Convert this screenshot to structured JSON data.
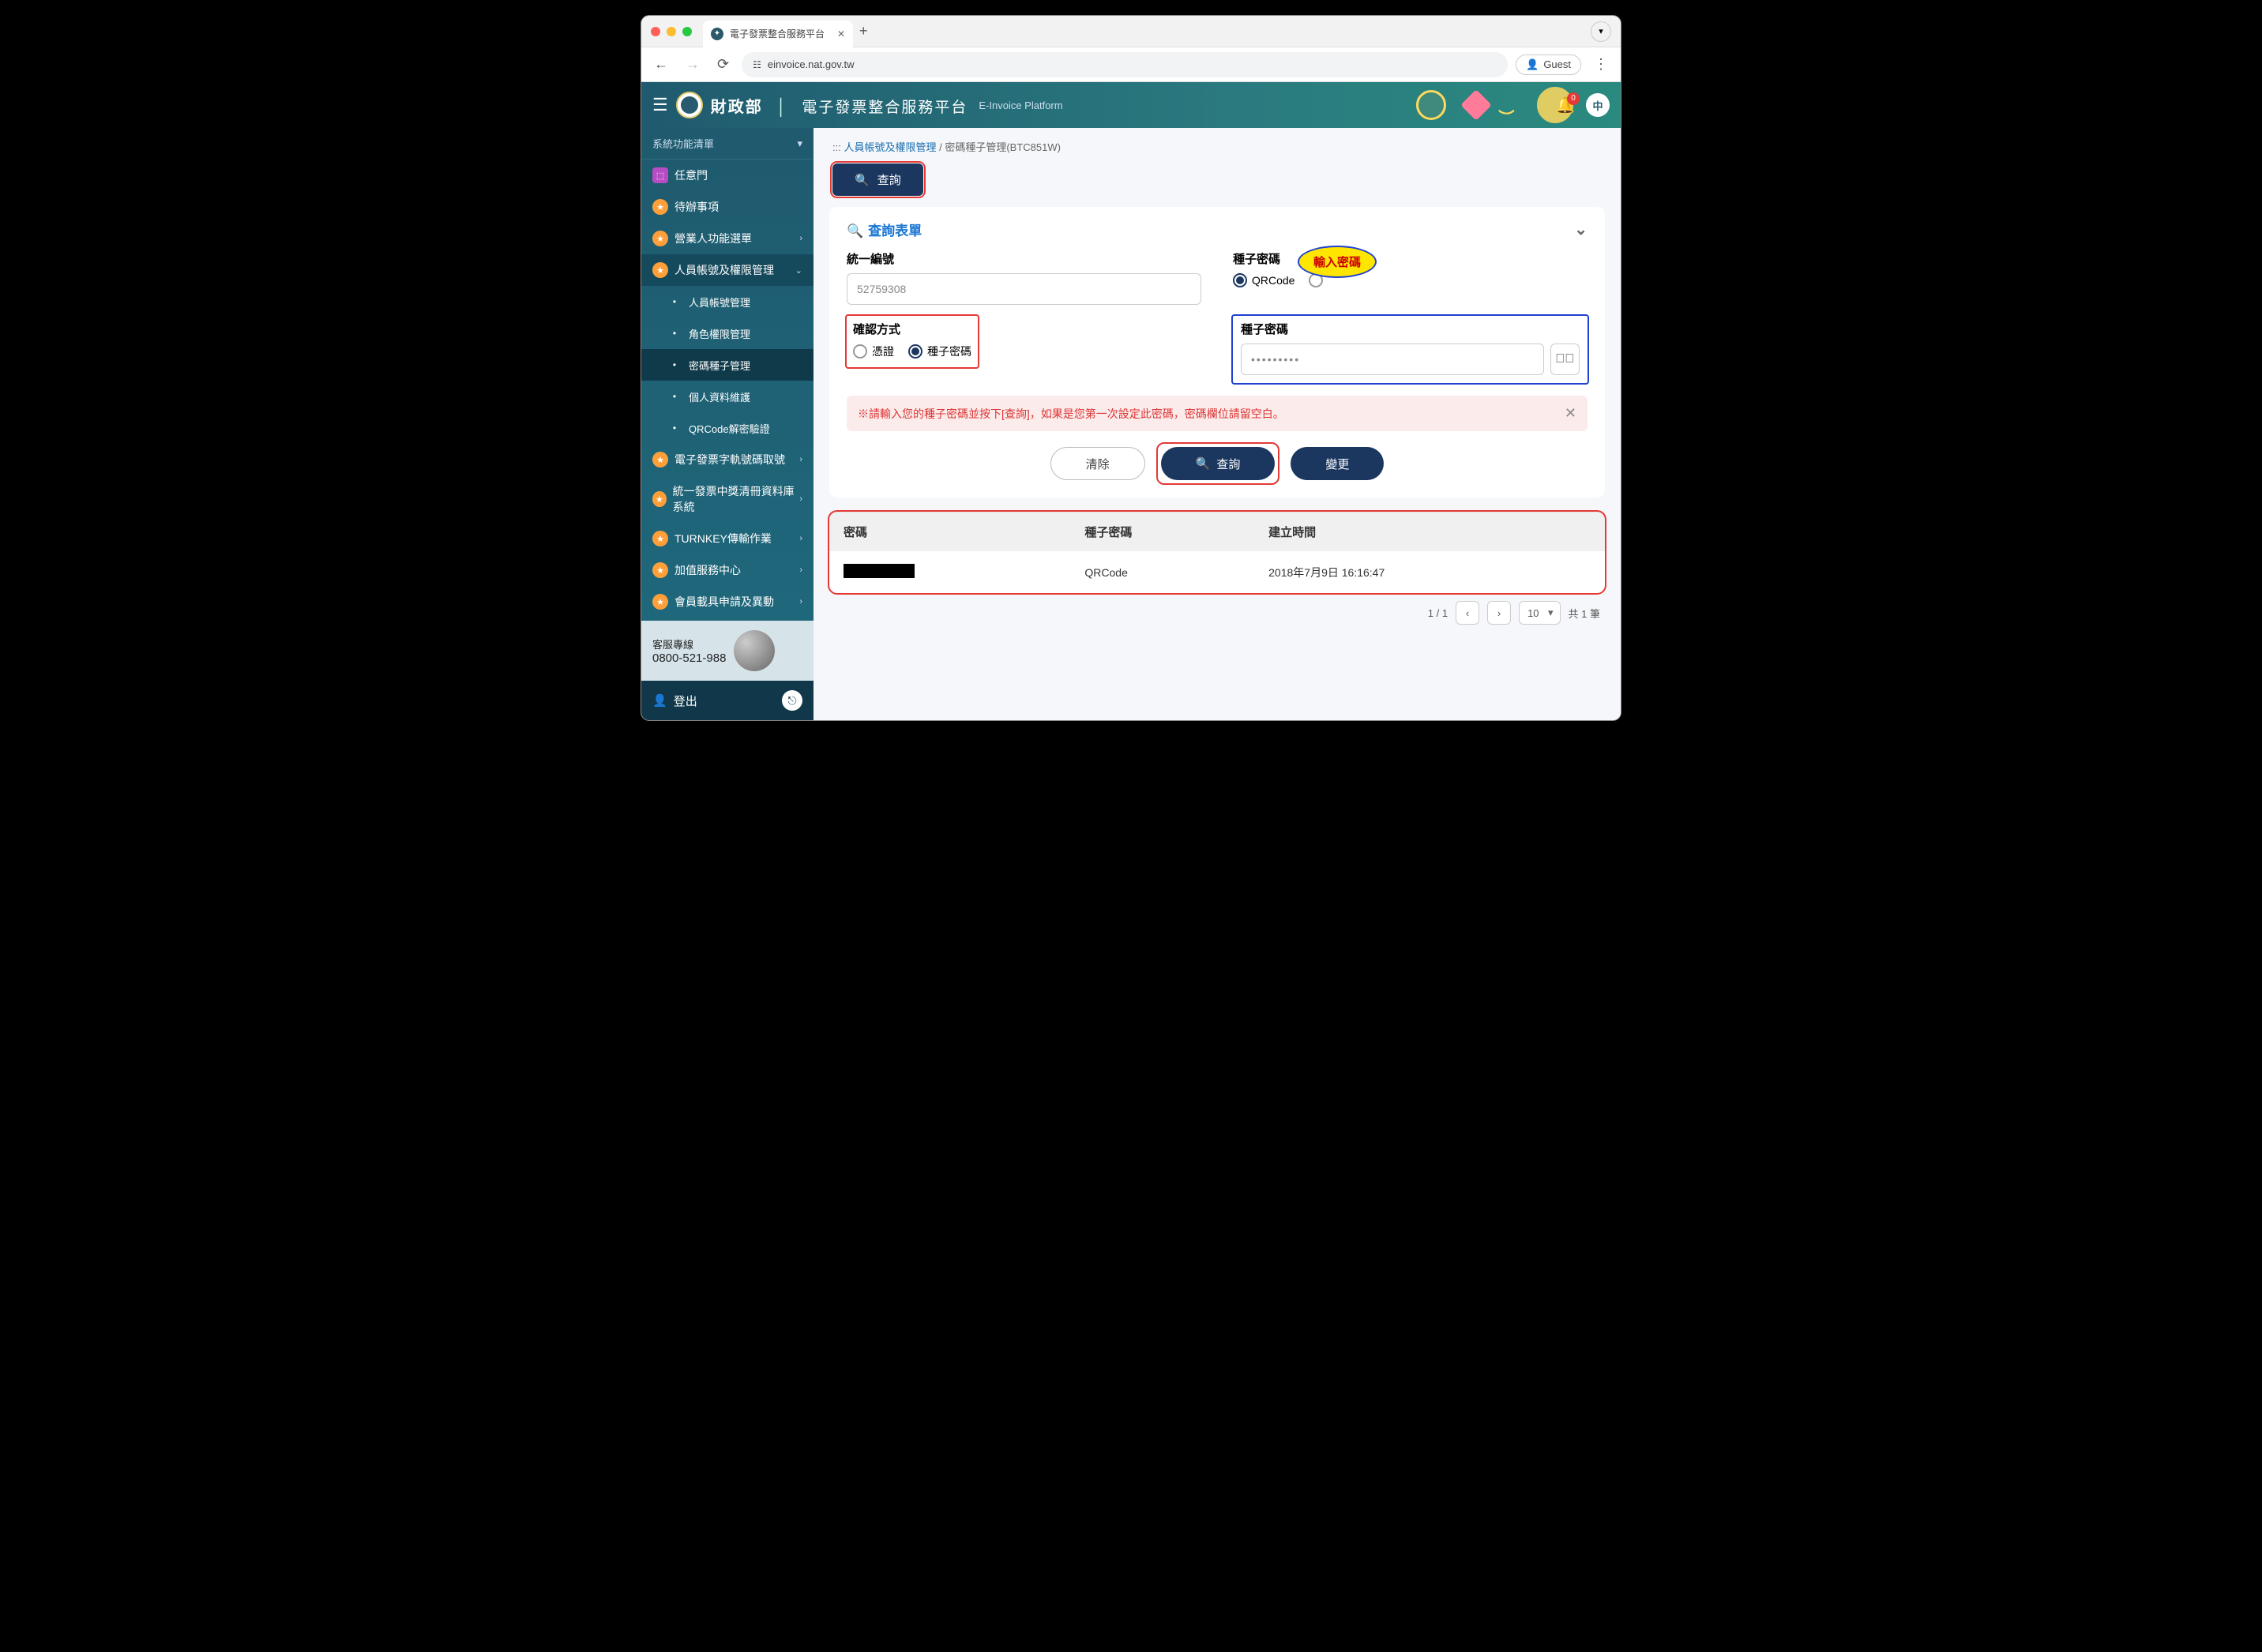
{
  "browser": {
    "tab_title": "電子發票整合服務平台",
    "url": "einvoice.nat.gov.tw",
    "guest": "Guest"
  },
  "header": {
    "ministry": "財政部",
    "title": "電子發票整合服務平台",
    "subtitle_en": "E-Invoice Platform",
    "notif_count": "0",
    "lang": "中"
  },
  "sidebar": {
    "heading": "系統功能清單",
    "items": [
      {
        "label": "任意門",
        "kind": "map"
      },
      {
        "label": "待辦事項",
        "kind": "star"
      },
      {
        "label": "營業人功能選單",
        "kind": "star",
        "chev": true
      },
      {
        "label": "人員帳號及權限管理",
        "kind": "star",
        "chev": true,
        "open": true
      },
      {
        "label": "人員帳號管理",
        "kind": "sub"
      },
      {
        "label": "角色權限管理",
        "kind": "sub"
      },
      {
        "label": "密碼種子管理",
        "kind": "sub",
        "selected": true
      },
      {
        "label": "個人資料維護",
        "kind": "sub"
      },
      {
        "label": "QRCode解密驗證",
        "kind": "sub"
      },
      {
        "label": "電子發票字軌號碼取號",
        "kind": "star",
        "chev": true
      },
      {
        "label": "統一發票中獎清冊資料庫系統",
        "kind": "star",
        "chev": true
      },
      {
        "label": "TURNKEY傳輸作業",
        "kind": "star",
        "chev": true
      },
      {
        "label": "加值服務中心",
        "kind": "star",
        "chev": true
      },
      {
        "label": "會員載具申請及異動",
        "kind": "star",
        "chev": true
      }
    ],
    "support_label": "客服專線",
    "support_phone": "0800-521-988",
    "logout": "登出"
  },
  "crumb": {
    "prefix": ":::",
    "a": "人員帳號及權限管理",
    "b": "密碼種子管理(BTC851W)"
  },
  "tabbtn": "查詢",
  "card": {
    "title": "查詢表單",
    "f_uni": "統一編號",
    "uni_value": "52759308",
    "f_seed": "種子密碼",
    "seed_opt1": "QRCode",
    "callout": "輸入密碼",
    "f_confirm": "確認方式",
    "confirm_opt1": "憑證",
    "confirm_opt2": "種子密碼",
    "f_pw": "種子密碼",
    "pw_value": "•••••••••",
    "alert": "※請輸入您的種子密碼並按下[查詢]，如果是您第一次設定此密碼，密碼欄位請留空白。",
    "btn_clear": "清除",
    "btn_query": "查詢",
    "btn_change": "變更"
  },
  "table": {
    "h1": "密碼",
    "h2": "種子密碼",
    "h3": "建立時間",
    "r_seed": "QRCode",
    "r_time": "2018年7月9日 16:16:47"
  },
  "pager": {
    "pos": "1 / 1",
    "size": "10",
    "total": "共 1 筆"
  }
}
